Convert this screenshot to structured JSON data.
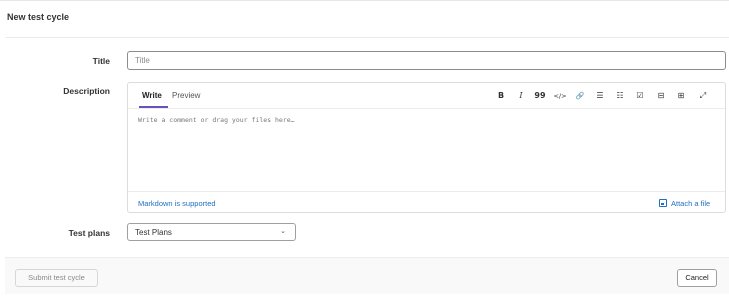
{
  "page": {
    "title": "New test cycle"
  },
  "form": {
    "title_label": "Title",
    "title_placeholder": "Title",
    "description_label": "Description",
    "test_plans_label": "Test plans"
  },
  "editor": {
    "tabs": [
      "Write",
      "Preview"
    ],
    "active_tab": "Write",
    "placeholder": "Write a comment or drag your files here…",
    "toolbar": [
      {
        "name": "bold",
        "glyph": "B"
      },
      {
        "name": "italic",
        "glyph": "I"
      },
      {
        "name": "quote",
        "glyph": "99"
      },
      {
        "name": "code",
        "glyph": "</>"
      },
      {
        "name": "link",
        "glyph": "🔗"
      },
      {
        "name": "bulleted-list",
        "glyph": "☰"
      },
      {
        "name": "numbered-list",
        "glyph": "☷"
      },
      {
        "name": "task-list",
        "glyph": "☑"
      },
      {
        "name": "collapsible",
        "glyph": "⊟"
      },
      {
        "name": "table",
        "glyph": "⊞"
      },
      {
        "name": "fullscreen",
        "glyph": "⤢"
      }
    ],
    "markdown_note": "Markdown is supported",
    "attach_label": "Attach a file"
  },
  "select": {
    "value": "Test Plans",
    "icon": "chevron-down-icon"
  },
  "footer": {
    "submit_label": "Submit test cycle",
    "cancel_label": "Cancel"
  },
  "colors": {
    "accent": "#6b4fbb",
    "link": "#1f6fc2"
  }
}
